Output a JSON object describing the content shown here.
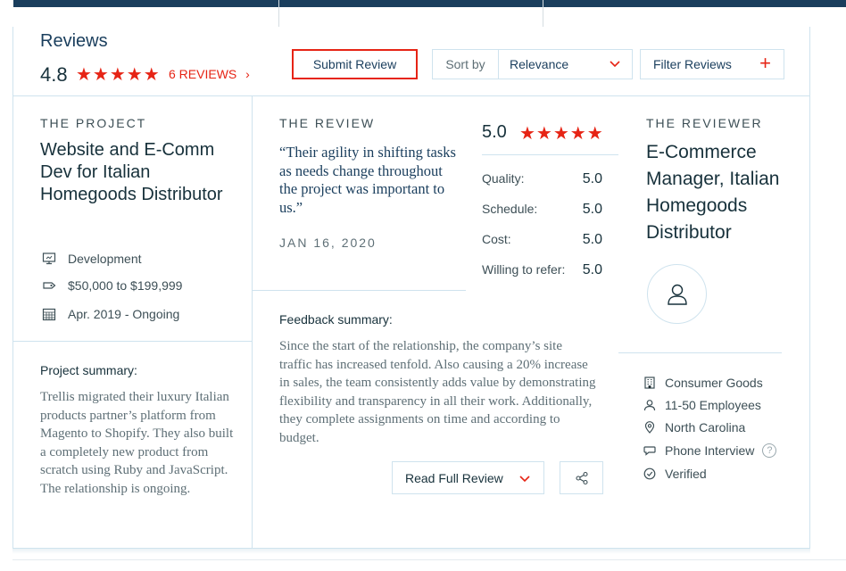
{
  "header": {
    "title": "Reviews",
    "rating": "4.8",
    "stars": "★★★★★",
    "reviews_link": "6 REVIEWS",
    "reviews_link_chevron": "›",
    "submit_label": "Submit Review",
    "sort_label": "Sort by",
    "sort_value": "Relevance",
    "filter_label": "Filter Reviews",
    "filter_plus": "+"
  },
  "project": {
    "section_label": "THE PROJECT",
    "title": "Website and E-Comm Dev for Italian Homegoods Distributor",
    "meta": [
      {
        "icon": "development-icon",
        "text": "Development"
      },
      {
        "icon": "budget-tag-icon",
        "text": "$50,000 to $199,999"
      },
      {
        "icon": "calendar-icon",
        "text": "Apr. 2019 - Ongoing"
      }
    ],
    "summary_heading": "Project summary:",
    "summary_text": "Trellis migrated their luxury Italian products partner’s platform from Magento to Shopify. They also built a completely new product from scratch using Ruby and JavaScript. The relationship is ongoing."
  },
  "review": {
    "section_label": "THE REVIEW",
    "quote": "“Their agility in shifting tasks as needs change throughout the project was important to us.”",
    "date": "JAN 16, 2020",
    "overall": "5.0",
    "stars": "★★★★★",
    "scores": [
      {
        "label": "Quality:",
        "value": "5.0"
      },
      {
        "label": "Schedule:",
        "value": "5.0"
      },
      {
        "label": "Cost:",
        "value": "5.0"
      },
      {
        "label": "Willing to refer:",
        "value": "5.0"
      }
    ],
    "feedback_heading": "Feedback summary:",
    "feedback_text": "Since the start of the relationship, the company’s site traffic has increased tenfold. Also causing a 20% increase in sales, the team consistently adds value by demonstrating flexibility and transparency in all their work. Additionally, they complete assignments on time and according to budget.",
    "read_full_label": "Read Full Review"
  },
  "reviewer": {
    "section_label": "THE REVIEWER",
    "title": "E-Commerce Manager, Italian Homegoods Distributor",
    "details": [
      {
        "icon": "building-icon",
        "text": "Consumer Goods"
      },
      {
        "icon": "person-icon",
        "text": "11-50 Employees"
      },
      {
        "icon": "location-pin-icon",
        "text": "North Carolina"
      },
      {
        "icon": "chat-bubble-icon",
        "text": "Phone Interview"
      },
      {
        "icon": "check-circle-icon",
        "text": "Verified"
      }
    ],
    "help_glyph": "?"
  },
  "colors": {
    "accent_red": "#e62415",
    "navy": "#1a3e5d",
    "border": "#cfe3ee"
  }
}
